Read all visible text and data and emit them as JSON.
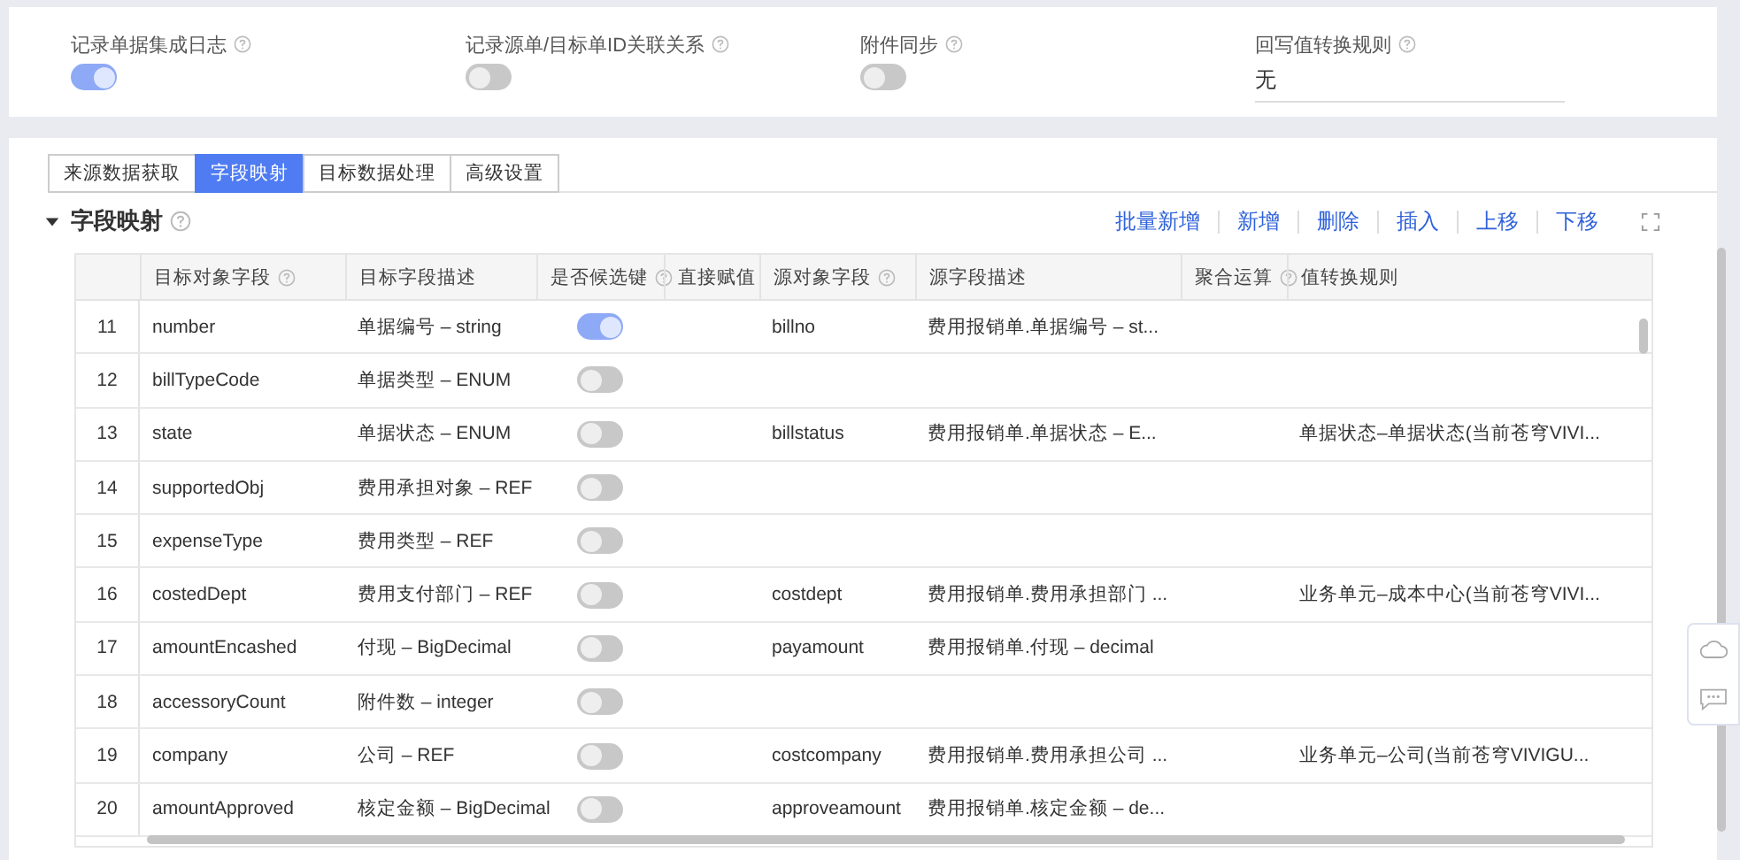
{
  "settings": [
    {
      "kind": "toggle",
      "label": "记录单据集成日志",
      "on": true
    },
    {
      "kind": "toggle",
      "label": "记录源单/目标单ID关联关系",
      "on": false
    },
    {
      "kind": "toggle",
      "label": "附件同步",
      "on": false
    },
    {
      "kind": "text",
      "label": "回写值转换规则",
      "value": "无"
    }
  ],
  "tabs": [
    {
      "label": "来源数据获取",
      "selected": false
    },
    {
      "label": "字段映射",
      "selected": true
    },
    {
      "label": "目标数据处理",
      "selected": false
    },
    {
      "label": "高级设置",
      "selected": false
    }
  ],
  "section": {
    "title": "字段映射",
    "expanded": true
  },
  "actions": [
    "批量新增",
    "新增",
    "删除",
    "插入",
    "上移",
    "下移"
  ],
  "table": {
    "columns": [
      {
        "label": "目标对象字段",
        "help": true
      },
      {
        "label": "目标字段描述",
        "help": false
      },
      {
        "label": "是否候选键",
        "help": true
      },
      {
        "label": "直接赋值",
        "help": false
      },
      {
        "label": "源对象字段",
        "help": true
      },
      {
        "label": "源字段描述",
        "help": false
      },
      {
        "label": "聚合运算",
        "help": true
      },
      {
        "label": "值转换规则",
        "help": false
      }
    ],
    "rows": [
      {
        "index": "11",
        "target": "number",
        "target_desc": "单据编号 – string",
        "candidate_key": true,
        "source": "billno",
        "source_desc": "费用报销单.单据编号 – st...",
        "rule": ""
      },
      {
        "index": "12",
        "target": "billTypeCode",
        "target_desc": "单据类型 – ENUM",
        "candidate_key": false,
        "source": "",
        "source_desc": "",
        "rule": ""
      },
      {
        "index": "13",
        "target": "state",
        "target_desc": "单据状态 – ENUM",
        "candidate_key": false,
        "source": "billstatus",
        "source_desc": "费用报销单.单据状态 – E...",
        "rule": "单据状态–单据状态(当前苍穹VIVI..."
      },
      {
        "index": "14",
        "target": "supportedObj",
        "target_desc": "费用承担对象 – REF",
        "candidate_key": false,
        "source": "",
        "source_desc": "",
        "rule": ""
      },
      {
        "index": "15",
        "target": "expenseType",
        "target_desc": "费用类型 – REF",
        "candidate_key": false,
        "source": "",
        "source_desc": "",
        "rule": ""
      },
      {
        "index": "16",
        "target": "costedDept",
        "target_desc": "费用支付部门 – REF",
        "candidate_key": false,
        "source": "costdept",
        "source_desc": "费用报销单.费用承担部门 ...",
        "rule": "业务单元–成本中心(当前苍穹VIVI..."
      },
      {
        "index": "17",
        "target": "amountEncashed",
        "target_desc": "付现 – BigDecimal",
        "candidate_key": false,
        "source": "payamount",
        "source_desc": "费用报销单.付现 – decimal",
        "rule": ""
      },
      {
        "index": "18",
        "target": "accessoryCount",
        "target_desc": "附件数 – integer",
        "candidate_key": false,
        "source": "",
        "source_desc": "",
        "rule": ""
      },
      {
        "index": "19",
        "target": "company",
        "target_desc": "公司 – REF",
        "candidate_key": false,
        "source": "costcompany",
        "source_desc": "费用报销单.费用承担公司 ...",
        "rule": "业务单元–公司(当前苍穹VIVIGU..."
      },
      {
        "index": "20",
        "target": "amountApproved",
        "target_desc": "核定金额 – BigDecimal",
        "candidate_key": false,
        "source": "approveamount",
        "source_desc": "费用报销单.核定金额 – de...",
        "rule": ""
      }
    ]
  }
}
